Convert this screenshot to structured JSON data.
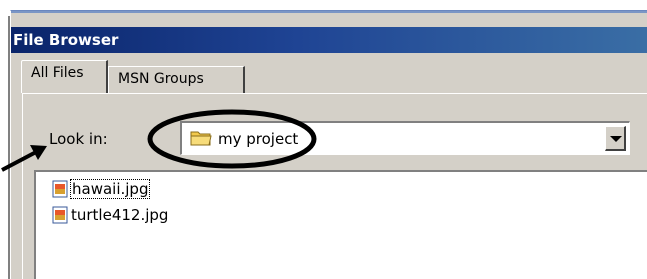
{
  "window": {
    "title": "File Browser"
  },
  "tabs": [
    {
      "label": "All Files",
      "active": true
    },
    {
      "label": "MSN Groups",
      "active": false
    }
  ],
  "look_in": {
    "label": "Look in:",
    "value": "my project",
    "icon": "folder-icon"
  },
  "files": [
    {
      "name": "hawaii.jpg",
      "icon": "image-file-icon",
      "selected": true
    },
    {
      "name": "turtle412.jpg",
      "icon": "image-file-icon",
      "selected": false
    }
  ],
  "colors": {
    "title_gradient_start": "#0a246a",
    "title_gradient_end": "#3a6ea5",
    "face": "#d4d0c8",
    "folder": "#f2c94c"
  }
}
